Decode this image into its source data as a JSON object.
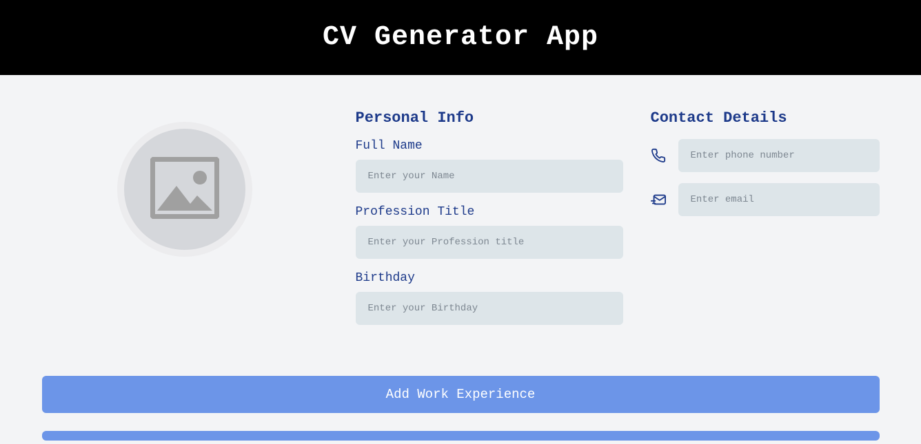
{
  "header": {
    "title": "CV Generator App"
  },
  "personal": {
    "section_title": "Personal Info",
    "full_name_label": "Full Name",
    "full_name_placeholder": "Enter your Name",
    "profession_label": "Profession Title",
    "profession_placeholder": "Enter your Profession title",
    "birthday_label": "Birthday",
    "birthday_placeholder": "Enter your Birthday"
  },
  "contact": {
    "section_title": "Contact Details",
    "phone_placeholder": "Enter phone number",
    "email_placeholder": "Enter email"
  },
  "buttons": {
    "add_work_experience": "Add Work Experience"
  }
}
